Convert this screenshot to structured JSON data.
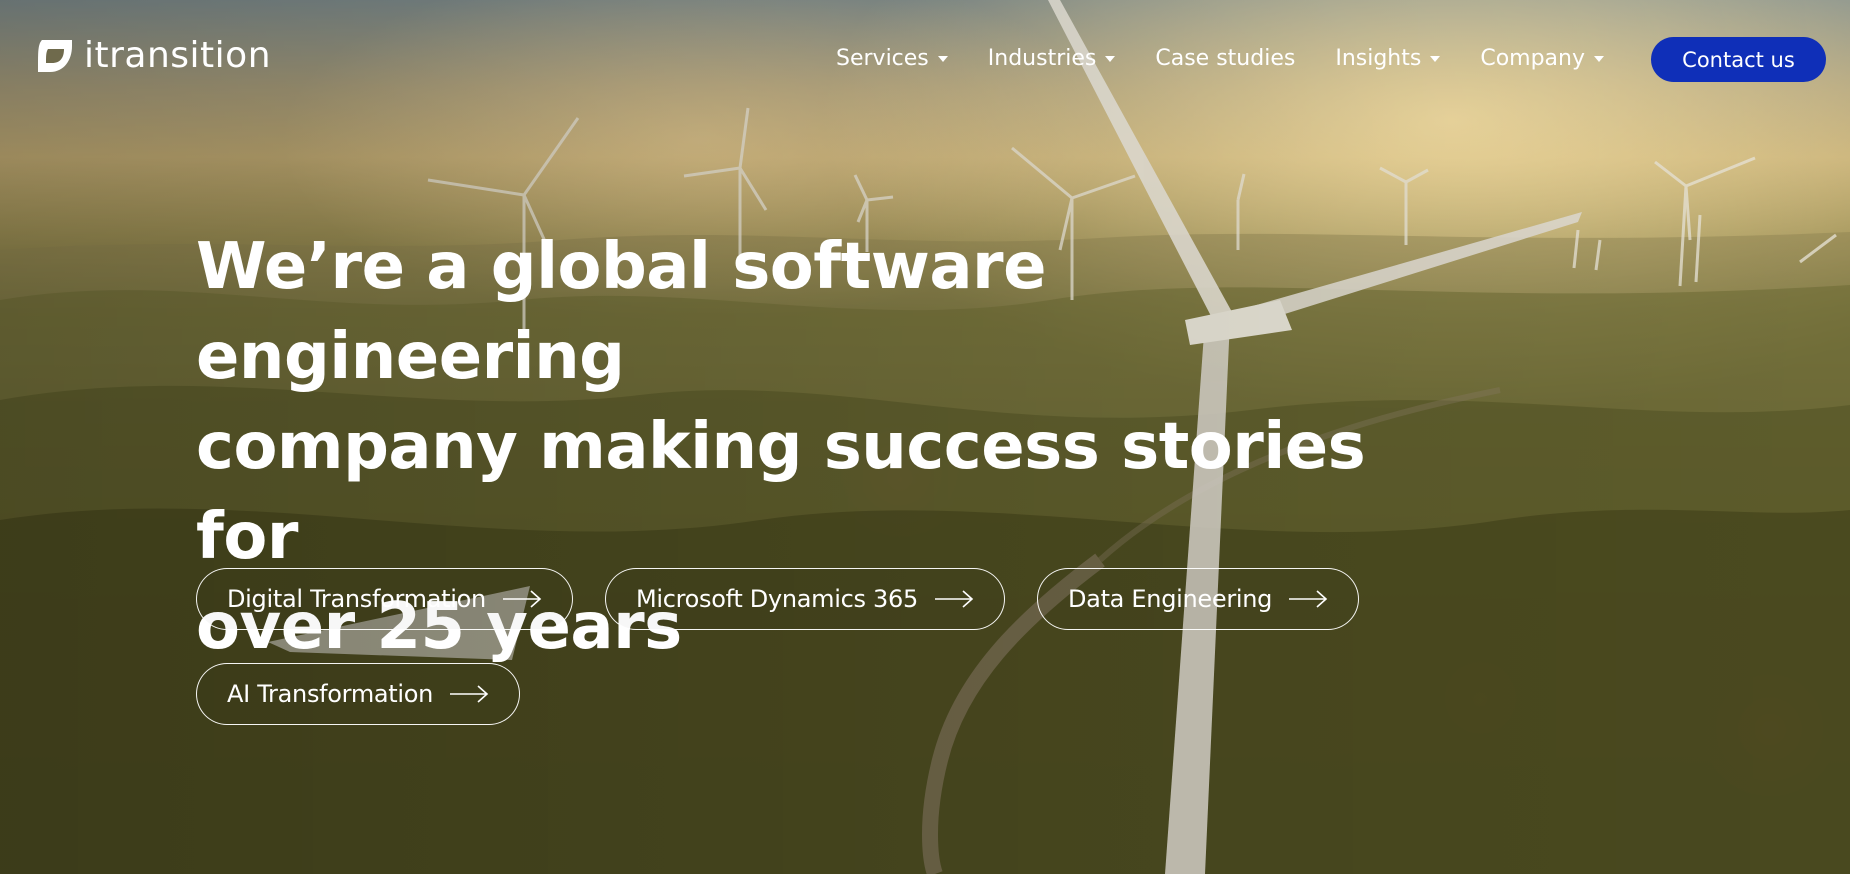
{
  "brand": {
    "name": "itransition"
  },
  "nav": {
    "items": [
      {
        "label": "Services",
        "dropdown": true
      },
      {
        "label": "Industries",
        "dropdown": true
      },
      {
        "label": "Case studies",
        "dropdown": false
      },
      {
        "label": "Insights",
        "dropdown": true
      },
      {
        "label": "Company",
        "dropdown": true
      }
    ],
    "cta_label": "Contact us"
  },
  "hero": {
    "headline_lines": [
      "We’re a global software engineering",
      "company making success stories for",
      "over 25 years"
    ],
    "pills": [
      {
        "label": "Digital Transformation",
        "icon": "arrow-right-icon"
      },
      {
        "label": "Microsoft Dynamics 365",
        "icon": "arrow-right-icon"
      },
      {
        "label": "Data Engineering",
        "icon": "arrow-right-icon"
      },
      {
        "label": "AI Transformation",
        "icon": "arrow-right-icon"
      }
    ]
  },
  "colors": {
    "cta_background": "#0f2fb8",
    "text": "#ffffff"
  }
}
